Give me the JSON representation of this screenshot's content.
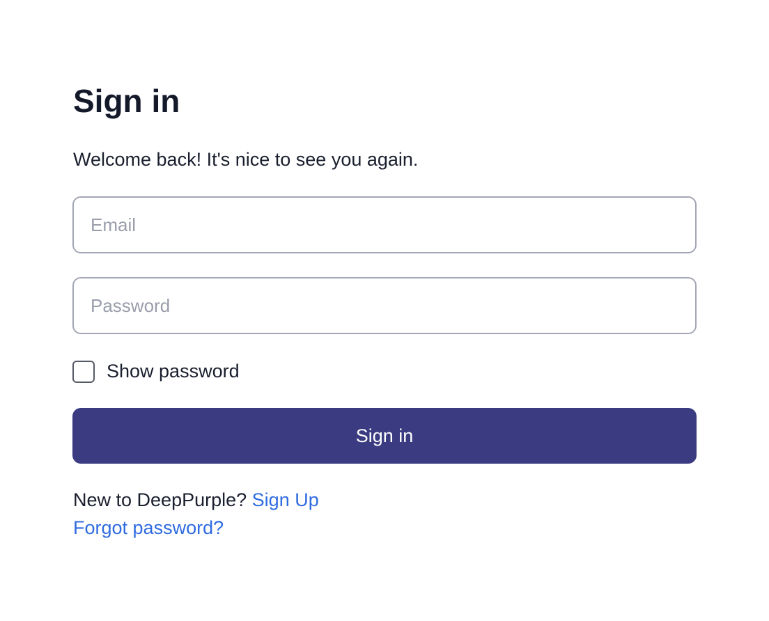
{
  "title": "Sign in",
  "subtitle": "Welcome back! It's nice to see you again.",
  "email": {
    "placeholder": "Email",
    "value": ""
  },
  "password": {
    "placeholder": "Password",
    "value": ""
  },
  "show_password_label": "Show password",
  "show_password_checked": false,
  "submit_label": "Sign in",
  "signup_prompt": "New to DeepPurple?",
  "signup_link": "Sign Up",
  "forgot_link": "Forgot password?",
  "colors": {
    "primary": "#3b3b82",
    "link": "#2f6be0"
  }
}
